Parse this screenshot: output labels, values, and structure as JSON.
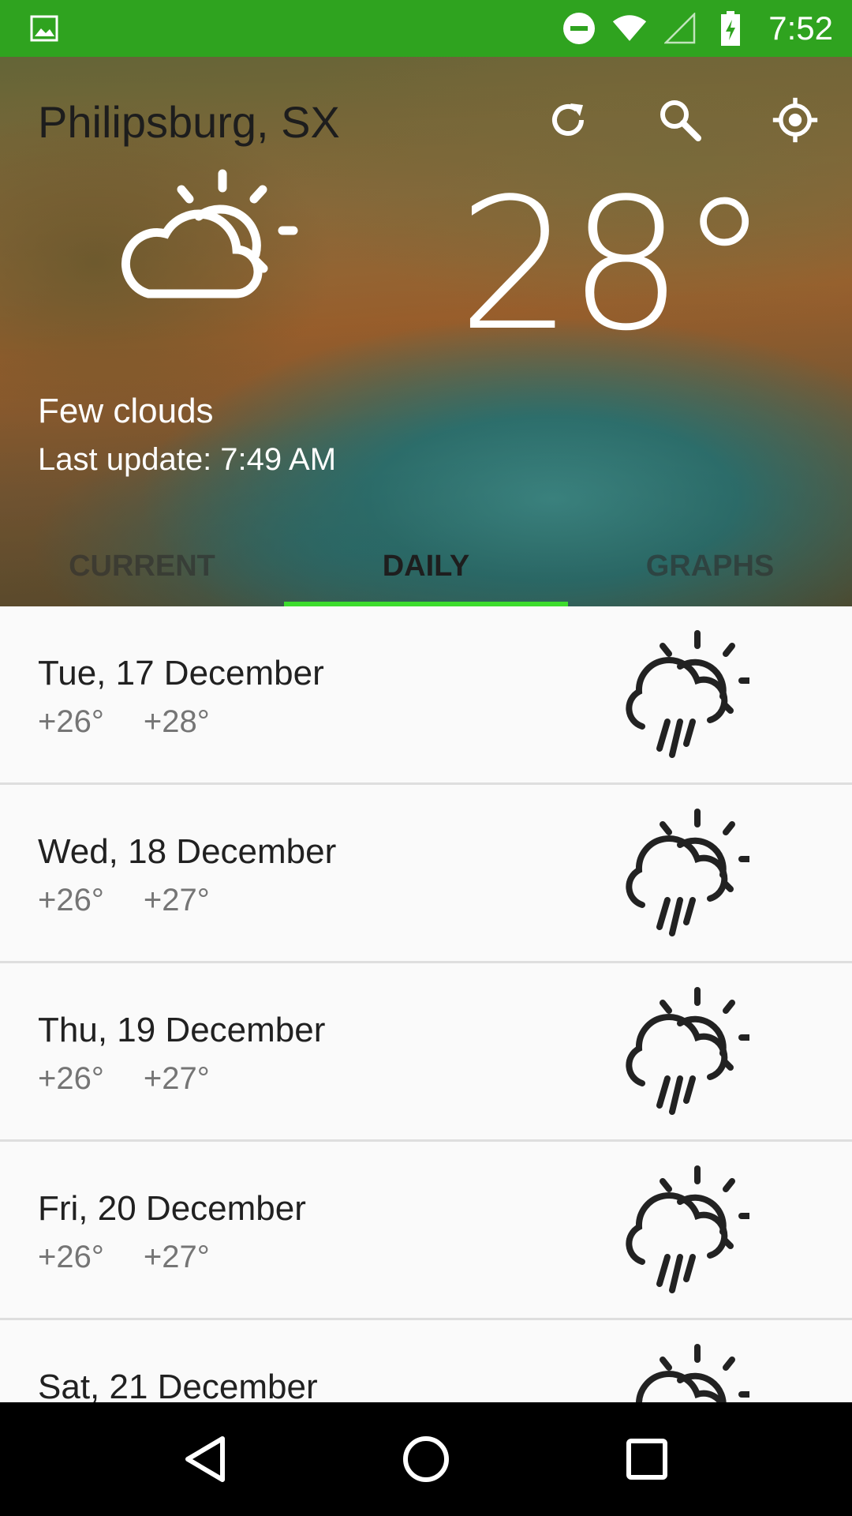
{
  "status_bar": {
    "time": "7:52",
    "icons": [
      "image-icon",
      "do-not-disturb-icon",
      "wifi-icon",
      "signal-icon",
      "battery-charging-icon"
    ],
    "color": "#2fa31f"
  },
  "header": {
    "city": "Philipsburg, SX",
    "temperature": "28°",
    "condition": "Few clouds",
    "last_update": "Last update: 7:49 AM",
    "actions": [
      "refresh-icon",
      "search-icon",
      "locate-icon"
    ],
    "weather_icon": "partly-cloudy-icon"
  },
  "tabs": [
    {
      "label": "CURRENT",
      "active": false
    },
    {
      "label": "DAILY",
      "active": true
    },
    {
      "label": "GRAPHS",
      "active": false
    }
  ],
  "accent_color": "#3ddc2d",
  "daily": [
    {
      "date": "Tue, 17 December",
      "low": "+26°",
      "high": "+28°",
      "icon": "rain-sun-icon"
    },
    {
      "date": "Wed, 18 December",
      "low": "+26°",
      "high": "+27°",
      "icon": "rain-sun-icon"
    },
    {
      "date": "Thu, 19 December",
      "low": "+26°",
      "high": "+27°",
      "icon": "rain-sun-icon"
    },
    {
      "date": "Fri, 20 December",
      "low": "+26°",
      "high": "+27°",
      "icon": "rain-sun-icon"
    },
    {
      "date": "Sat, 21 December",
      "low": "",
      "high": "",
      "icon": "rain-sun-icon"
    }
  ],
  "nav_bar": [
    "back-icon",
    "home-icon",
    "recents-icon"
  ]
}
